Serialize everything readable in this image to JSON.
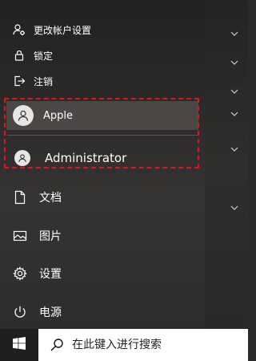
{
  "account_menu": {
    "change_settings": "更改帐户设置",
    "lock": "锁定",
    "sign_out": "注销"
  },
  "users": [
    {
      "name": "Apple",
      "icon": "user-avatar-icon"
    },
    {
      "name": "Administrator",
      "icon": "user-avatar-icon"
    }
  ],
  "nav": {
    "documents": "文档",
    "pictures": "图片",
    "settings": "设置",
    "power": "电源"
  },
  "taskbar": {
    "search_placeholder": "在此键入进行搜索"
  },
  "colors": {
    "highlight": "#e2141b",
    "taskbar": "#101010",
    "search_bg": "#ffffff"
  }
}
